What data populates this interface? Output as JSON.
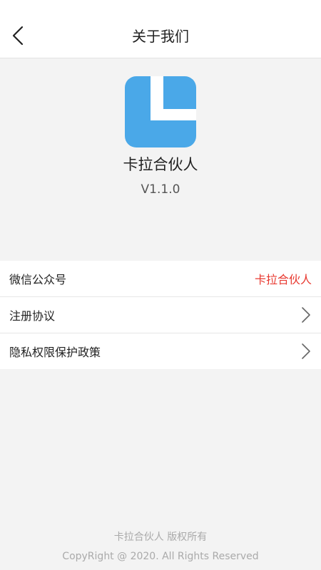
{
  "header": {
    "title": "关于我们",
    "back_icon": "chevron-left-icon"
  },
  "app": {
    "name": "卡拉合伙人",
    "version": "V1.1.0",
    "logo_color": "#4aa8e8"
  },
  "list": {
    "items": [
      {
        "label": "微信公众号",
        "value": "卡拉合伙人",
        "icon": ""
      },
      {
        "label": "注册协议",
        "value": "",
        "icon": "chevron-right-icon"
      },
      {
        "label": "隐私权限保护政策",
        "value": "",
        "icon": "chevron-right-icon"
      }
    ]
  },
  "footer": {
    "rights": "卡拉合伙人 版权所有",
    "copyright": "CopyRight @ 2020. All Rights Reserved"
  },
  "colors": {
    "accent": "#e8382f",
    "background": "#f3f3f3"
  }
}
